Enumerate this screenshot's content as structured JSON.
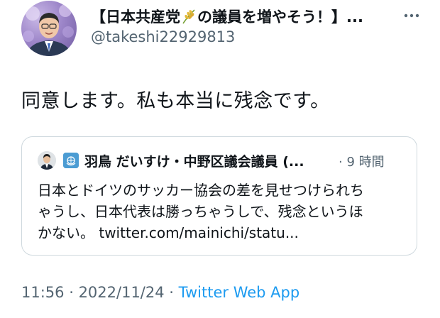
{
  "author": {
    "display_name_prefix": "【日本共産党",
    "display_name_suffix": "の議員を増やそう！】...",
    "display_name_emoji": "rice-plant-icon",
    "handle": "@takeshi22929813",
    "more_icon": "more-icon"
  },
  "tweet": {
    "text": "同意します。私も本当に残念です。"
  },
  "quote": {
    "flag_icon": "un-flag-icon",
    "author_name": "羽鳥 だいすけ・中野区議会議員 (...",
    "meta": "· 9 時間",
    "text_lines": [
      "日本とドイツのサッカー協会の差を見せつけられち",
      "ゃうし、日本代表は勝っちゃうしで、残念というほ",
      "かない。 twitter.com/mainichi/statu..."
    ]
  },
  "footer": {
    "time": "11:56",
    "sep1": " · ",
    "date": "2022/11/24",
    "sep2": " · ",
    "app": "Twitter Web App"
  },
  "colors": {
    "text": "#0f1419",
    "secondary": "#536471",
    "link": "#1d9bf0",
    "border": "#cfd9de"
  }
}
